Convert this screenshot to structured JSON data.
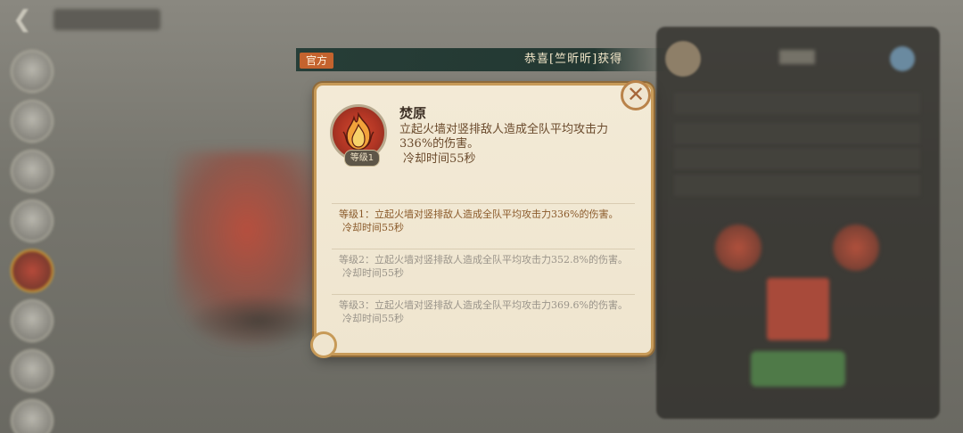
{
  "banner": {
    "tag": "官方",
    "message": "恭喜[竺昕昕]获得"
  },
  "skill": {
    "name": "焚原",
    "description": "立起火墙对竖排敌人造成全队平均攻击力336%的伤害。",
    "cooldown": "冷却时间55秒",
    "level_badge": "等级1",
    "icon": "flame-icon"
  },
  "levels": [
    {
      "text": "等级1：立起火墙对竖排敌人造成全队平均攻击力336%的伤害。",
      "cooldown": "冷却时间55秒",
      "active": true
    },
    {
      "text": "等级2：立起火墙对竖排敌人造成全队平均攻击力352.8%的伤害。",
      "cooldown": "冷却时间55秒",
      "active": false
    },
    {
      "text": "等级3：立起火墙对竖排敌人造成全队平均攻击力369.6%的伤害。",
      "cooldown": "冷却时间55秒",
      "active": false
    }
  ],
  "close": {
    "icon": "close-icon"
  },
  "colors": {
    "card_bg": "#efe5cf",
    "card_border": "#c79a58",
    "banner_bg": "#223a34",
    "banner_tag": "#c4632e",
    "active_level": "#8a5a2a",
    "inactive_level": "#9a948a"
  }
}
